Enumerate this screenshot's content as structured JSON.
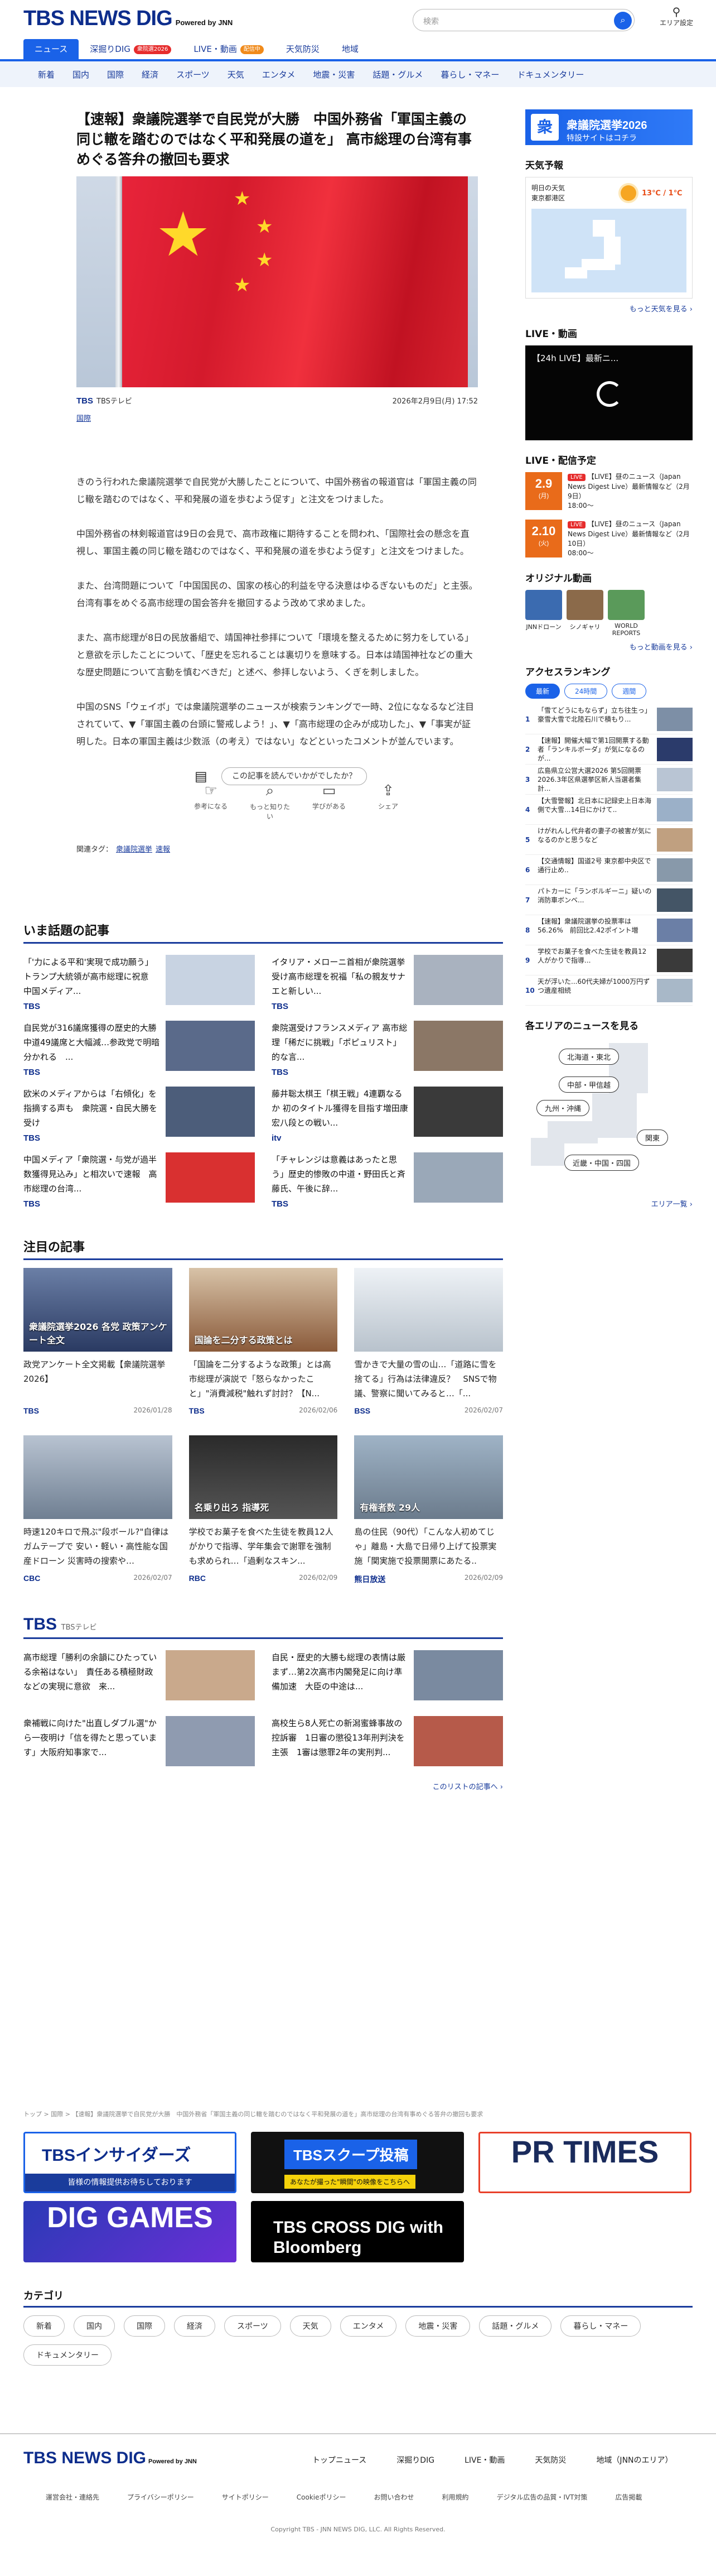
{
  "site": {
    "logo": "TBS NEWS DIG",
    "powered": "Powered by JNN",
    "search_placeholder": "検索",
    "area_label": "エリア設定"
  },
  "nav_main": [
    {
      "label": "ニュース",
      "tag": ""
    },
    {
      "label": "深掘りDIG",
      "tag": "衆院選2026"
    },
    {
      "label": "LIVE・動画",
      "tag": "配信中"
    },
    {
      "label": "天気防災",
      "tag": ""
    },
    {
      "label": "地域",
      "tag": ""
    }
  ],
  "nav_sub": [
    "新着",
    "国内",
    "国際",
    "経済",
    "スポーツ",
    "天気",
    "エンタメ",
    "地震・災害",
    "話題・グルメ",
    "暮らし・マネー",
    "ドキュメンタリー"
  ],
  "article": {
    "title": "【速報】衆議院選挙で自民党が大勝　中国外務省「軍国主義の同じ轍を踏むのではなく平和発展の道を」 高市総理の台湾有事めぐる答弁の撤回も要求",
    "source": "TBSテレビ",
    "datetime": "2026年2月9日(月) 17:52",
    "category": "国際",
    "paragraphs": [
      "きのう行われた衆議院選挙で自民党が大勝したことについて、中国外務省の報道官は「軍国主義の同じ轍を踏むのではなく、平和発展の道を歩むよう促す」と注文をつけました。",
      "中国外務省の林剣報道官は9日の会見で、高市政権に期待することを問われ、「国際社会の懸念を直視し、軍国主義の同じ轍を踏むのではなく、平和発展の道を歩むよう促す」と注文をつけました。",
      "また、台湾問題について「中国国民の、国家の核心的利益を守る決意はゆるぎないものだ」と主張。台湾有事をめぐる高市総理の国会答弁を撤回するよう改めて求めました。",
      "また、高市総理が8日の民放番組で、靖国神社参拝について「環境を整えるために努力をしている」と意欲を示したことについて、「歴史を忘れることは裏切りを意味する。日本は靖国神社などの重大な歴史問題について言動を慎むべきだ」と述べ、参拝しないよう、くぎを刺しました。",
      "中国のSNS「ウェイボ」では衆議院選挙のニュースが検索ランキングで一時、2位にななるなど注目されていて、▼「軍国主義の台頭に警戒しよう！」、▼「高市総理の企みが成功した」、▼「事実が証明した。日本の軍国主義は少数派（の考え）ではない」などといったコメントが並んでいます。"
    ],
    "feedback_q": "この記事を読んでいかがでしたか？",
    "reactions": [
      "参考になる",
      "もっと知りたい",
      "学びがある",
      "シェア"
    ],
    "tags_label": "関連タグ：",
    "tags": [
      "衆議院選挙",
      "速報"
    ]
  },
  "trending": {
    "heading": "いま話題の記事",
    "items": [
      {
        "t": "「'力による平和'実現で成功願う」トランプ大統領が高市総理に祝意　中国メディア...",
        "s": "TBS"
      },
      {
        "t": "イタリア・メローニ首相が衆院選挙受け高市総理を祝福「私の親友サナエと新しい...",
        "s": "TBS"
      },
      {
        "t": "自民党が316議席獲得の歴史的大勝　中道49議席と大幅減…参政党で明暗分かれる　...",
        "s": "TBS"
      },
      {
        "t": "衆院選受けフランスメディア 高市総理「稀だに挑戦」「ポピュリスト」的な言...",
        "s": "TBS"
      },
      {
        "t": "欧米のメディアからは「右傾化」を指摘する声も　衆院選・自民大勝を受け",
        "s": "TBS"
      },
      {
        "t": "藤井聡太棋王「棋王戦」4連覇なるか 初のタイトル獲得を目指す増田康宏八段との戦い...",
        "s": "itv"
      },
      {
        "t": "中国メディア「衆院選・与党が過半数獲得見込み」と相次いで速報　高市総理の台湾...",
        "s": "TBS"
      },
      {
        "t": "「チャレンジは意義はあったと思う」歴史的惨敗の中道・野田氏と斉藤氏、午後に辞...",
        "s": "TBS"
      }
    ]
  },
  "featured": {
    "heading": "注目の記事",
    "items": [
      {
        "t": "政党アンケート全文掲載【衆議院選挙2026】",
        "s": "TBS",
        "d": "2026/01/28",
        "img": "衆議院選挙2026 各党 政策アンケート全文"
      },
      {
        "t": "「国論を二分するような政策」とは高市総理が演説で「怒らなかったこと」\"消費減税\"触れず討討？【N...",
        "s": "TBS",
        "d": "2026/02/06",
        "img": "国論を二分する政策とは"
      },
      {
        "t": "雪かきで大量の雪の山…「道路に雪を捨てる」行為は法律違反？　SNSで物議、警察に聞いてみると…「...",
        "s": "BSS",
        "d": "2026/02/07",
        "img": ""
      },
      {
        "t": "時速120キロで飛ぶ\"段ボール?\"自律はガムテープで 安い・軽い・高性能な国産ドローン 災害時の搜索や…",
        "s": "CBC",
        "d": "2026/02/07",
        "img": ""
      },
      {
        "t": "学校でお菓子を食べた生徒を教員12人がかりで指導、学年集会で謝罪を強制も求められ…「過剰なスキン...",
        "s": "RBC",
        "d": "2026/02/09",
        "img": "名乗り出ろ 指導死"
      },
      {
        "t": "島の住民（90代）「こんな人初めてじゃ」離島・大島で日帰り上げて投票実施「関実施で投票開票にあたる..",
        "s": "熊日放送",
        "d": "2026/02/09",
        "img": "有権者数 29人"
      }
    ]
  },
  "tbs": {
    "heading": "TBS",
    "sub": "TBSテレビ",
    "items": [
      "高市総理「勝利の余韻にひたっている余裕はない」　責任ある積極財政などの実現に意欲　来...",
      "自民・歴史的大勝も総理の表情は厳まず…第2次高市内閣発足に向け準備加速　大臣の中途は...",
      "衆補戦に向けた\"出直しダブル選\"から一夜明け「信を得たと思っています」大阪府知事家で...",
      "高校生ら8人死亡の新潟蜜蜂事故の控訴審　1日審の懲役13年刑判決を主張　1審は懲罪2年の実刑判..."
    ],
    "more": "このリストの記事へ ›"
  },
  "breadcrumb": "トップ > 国際 > 【速報】衆議院選挙で自民党が大勝　中国外務省「軍国主義の同じ轍を踏むのではなく平和発展の道を」高市総理の台湾有事めぐる答弁の撤回も要求",
  "banners": [
    "TBSインサイダーズ",
    "TBSスクープ投稿",
    "PR TIMES",
    "DIG GAMES",
    "TBS CROSS DIG with Bloomberg"
  ],
  "banner_sub": [
    "皆様の情報提供お待ちしております",
    "あなたが撮った\"瞬間\"の映像をこちらへ"
  ],
  "categories": {
    "heading": "カテゴリ",
    "items": [
      "新着",
      "国内",
      "国際",
      "経済",
      "スポーツ",
      "天気",
      "エンタメ",
      "地震・災害",
      "話題・グルメ",
      "暮らし・マネー",
      "ドキュメンタリー"
    ]
  },
  "sidebar": {
    "election_banner": "衆議院選挙2026",
    "election_sub": "特設サイトはコチラ",
    "weather_h": "天気予報",
    "weather_when": "明日の天気",
    "weather_place": "東京都港区",
    "weather_temp": "13℃ / 1℃",
    "more_weather": "もっと天気を見る ›",
    "live_h": "LIVE・動画",
    "live_title": "【24h LIVE】最新ニ...",
    "sched_h": "LIVE・配信予定",
    "sched": [
      {
        "date": "2.9",
        "dow": "(月)",
        "t": "【LIVE】昼のニュース（Japan News Digest Live）最新情報など（2月9日）",
        "time": "18:00～"
      },
      {
        "date": "2.10",
        "dow": "(火)",
        "t": "【LIVE】昼のニュース（Japan News Digest Live）最新情報など（2月10日）",
        "time": "08:00～"
      }
    ],
    "orig_h": "オリジナル動画",
    "orig": [
      "JNNドローン",
      "シノギャリ",
      "WORLD REPORTS"
    ],
    "more_video": "もっと動画を見る ›",
    "rank_h": "アクセスランキング",
    "rank_tabs": [
      "最新",
      "24時間",
      "週間"
    ],
    "ranking": [
      "「雪てどうにもならず」立ち往生っ」豪雪大雪で北陸石川で積もり...",
      "【速報】開催大幅で第1回開票する動者「ランキルボーダ」が気になるのが...",
      "広島県立公営大選2026 第5回開票2026.3年区県選挙区新人当選者集計...",
      "【大雪警報】北日本に記録史上日本海側で大雪...14日にかけて..",
      "けがれんし代弁者の妻子の被害が気になるのかと思うなど",
      "【交通情報】国道2号 東京都中央区で通行止め..",
      "パトカーに「ランボルギーニ」疑いの消防車ボンベ...",
      "【速報】衆議院選挙の投票率は56.26%　前回比2.42ポイント増",
      "学校でお菓子を食べた生徒を教員12人がかりで指導...",
      "天が浮いた...60代夫婦が1000万円ずつ遺産相続"
    ],
    "area_h": "各エリアのニュースを見る",
    "areas": [
      "北海道・東北",
      "中部・甲信越",
      "九州・沖縄",
      "関東",
      "近畿・中国・四国"
    ],
    "area_more": "エリア一覧 ›"
  },
  "footer": {
    "links1": [
      "トップニュース",
      "深掘りDIG",
      "LIVE・動画",
      "天気防災",
      "地域（JNNのエリア）"
    ],
    "links2": [
      "運営会社・連絡先",
      "プライバシーポリシー",
      "サイトポリシー",
      "Cookieポリシー",
      "お問い合わせ",
      "利用規約",
      "デジタル広告の品質・IVT対策",
      "広告掲載"
    ],
    "copyright": "Copyright TBS - JNN NEWS DIG, LLC. All Rights Reserved."
  }
}
